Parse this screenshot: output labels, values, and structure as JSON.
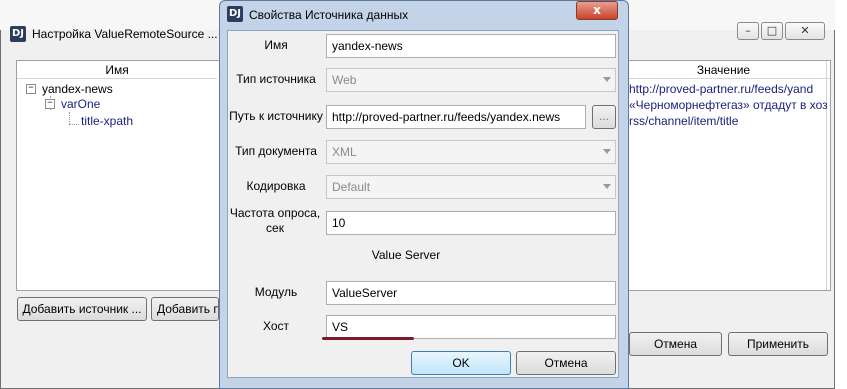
{
  "main_window": {
    "title": "Настройка ValueRemoteSource ...",
    "app_icon": "DJ",
    "columns": {
      "name": "Имя",
      "value": "Значение"
    },
    "tree": [
      {
        "label": "yandex-news",
        "value": "http://proved-partner.ru/feeds/yand"
      },
      {
        "label": "varOne",
        "value": "«Черноморнефтегаз» отдадут в хоз"
      },
      {
        "label": "title-xpath",
        "value": "rss/channel/item/title"
      }
    ],
    "add_source_button": "Добавить источник ...",
    "add_var_button": "Добавить п",
    "cancel_button": "Отмена",
    "apply_button": "Применить"
  },
  "dialog": {
    "title": "Свойства Источника данных",
    "app_icon": "DJ",
    "close_glyph": "x",
    "fields": {
      "name_label": "Имя",
      "name_value": "yandex-news",
      "source_type_label": "Тип источника",
      "source_type_value": "Web",
      "source_path_label": "Путь к источнику",
      "source_path_value": "http://proved-partner.ru/feeds/yandex.news",
      "browse_button": "...",
      "doc_type_label": "Тип документа",
      "doc_type_value": "XML",
      "encoding_label": "Кодировка",
      "encoding_value": "Default",
      "poll_label_line1": "Частота опроса,",
      "poll_label_line2": "сек",
      "poll_value": "10"
    },
    "section_heading": "Value Server",
    "module_label": "Модуль",
    "module_value": "ValueServer",
    "host_label": "Хост",
    "host_value": "VS",
    "ok_button": "OK",
    "cancel_button": "Отмена"
  }
}
